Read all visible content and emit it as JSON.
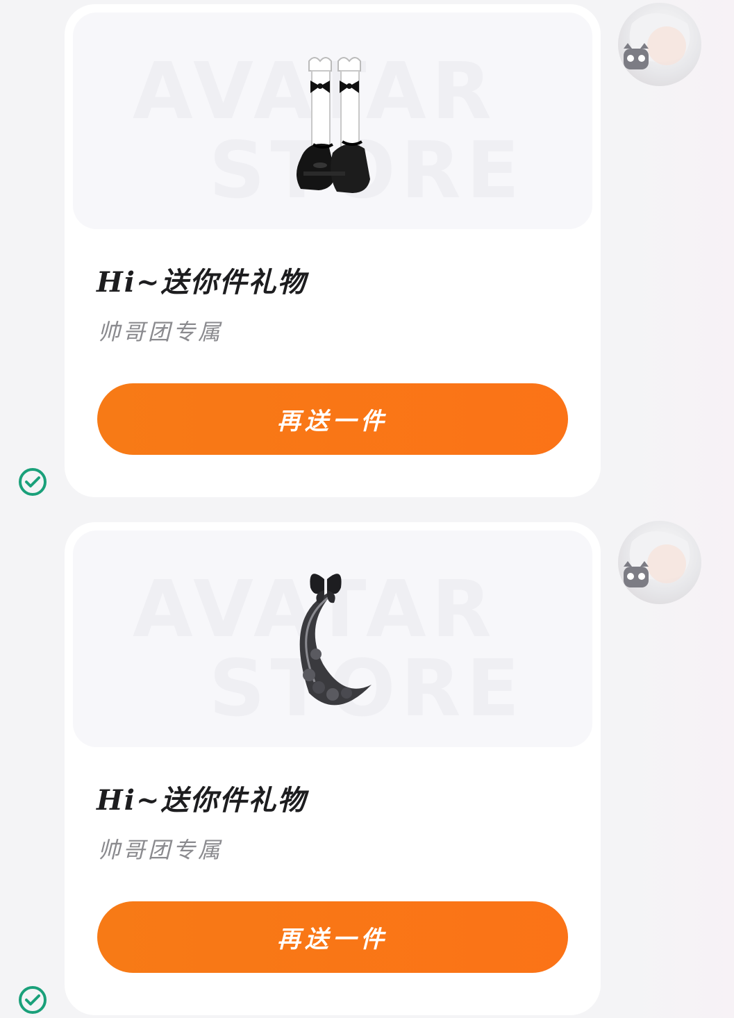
{
  "messages": [
    {
      "gift_title": "Hi~送你件礼物",
      "gift_subtitle": "帅哥团专属",
      "button_label": "再送一件",
      "image_icon": "shoes-with-socks-icon",
      "watermark_line1": "AVATAR",
      "watermark_line2": "STORE",
      "status_icon": "check-circle-icon"
    },
    {
      "gift_title": "Hi~送你件礼物",
      "gift_subtitle": "帅哥团专属",
      "button_label": "再送一件",
      "image_icon": "crescent-moon-butterfly-icon",
      "watermark_line1": "AVATAR",
      "watermark_line2": "STORE",
      "status_icon": "check-circle-icon"
    }
  ],
  "colors": {
    "button": "#fb7317",
    "check": "#1aa07a",
    "title": "#1d1d1f",
    "subtitle": "#8a8a8e"
  }
}
